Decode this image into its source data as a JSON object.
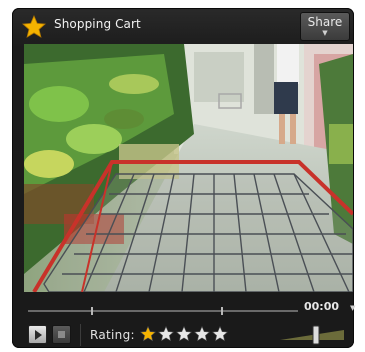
{
  "header": {
    "title": "Shopping Cart",
    "share_label": "Share"
  },
  "playback": {
    "time": "00:00",
    "progress": 0
  },
  "rating": {
    "label": "Rating:",
    "value": 1,
    "max": 5
  },
  "volume": {
    "level": 0.6
  },
  "colors": {
    "star_filled": "#f5b300",
    "star_empty": "#e6e6e6",
    "cart_red": "#c8322a"
  },
  "icons": {
    "title_badge": "star-icon",
    "play": "play-icon",
    "stop": "stop-icon"
  }
}
